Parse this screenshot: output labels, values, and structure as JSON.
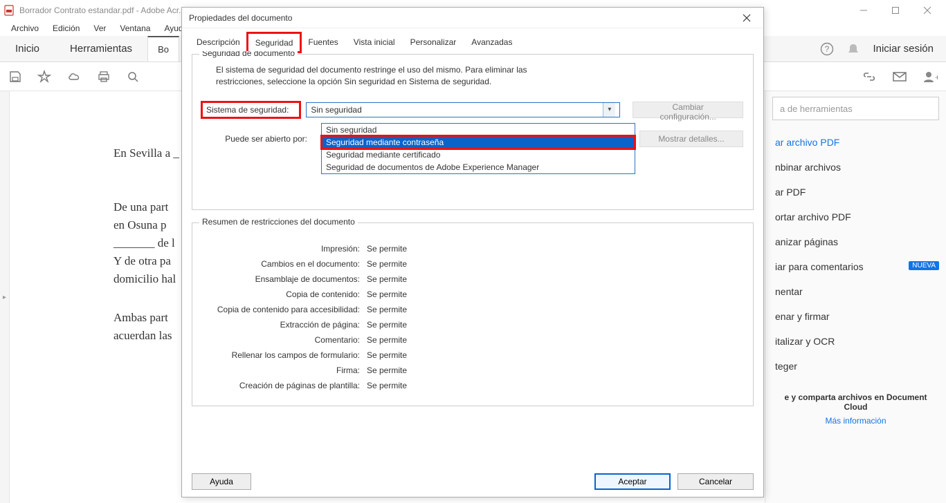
{
  "window": {
    "title": "Borrador Contrato estandar.pdf - Adobe Acr...",
    "controls": {
      "minimize": "min",
      "maximize": "max",
      "close": "close"
    }
  },
  "menubar": [
    "Archivo",
    "Edición",
    "Ver",
    "Ventana",
    "Ayuda"
  ],
  "tabbar": {
    "home": "Inicio",
    "tools": "Herramientas",
    "doctab": "Bo",
    "signin": "Iniciar sesión"
  },
  "rightpanel": {
    "search_placeholder": "a de herramientas",
    "items": [
      {
        "label": "ar archivo PDF",
        "blue": true
      },
      {
        "label": "nbinar archivos"
      },
      {
        "label": "ar PDF"
      },
      {
        "label": "ortar archivo PDF"
      },
      {
        "label": "anizar páginas"
      },
      {
        "label": "iar para comentarios",
        "badge": "NUEVA"
      },
      {
        "label": "nentar"
      },
      {
        "label": "enar y firmar"
      },
      {
        "label": "italizar y OCR"
      },
      {
        "label": "teger"
      }
    ],
    "promo_title": "e y comparta archivos en Document Cloud",
    "promo_link": "Más información"
  },
  "document": {
    "line1": "En Sevilla a _",
    "p1a": "  De una part",
    "p1b": "en  Osuna  p",
    "p1c": "_______ de l",
    "p1d": "  Y de otra pa",
    "p1e": "domicilio hal",
    "p2a": "  Ambas part",
    "p2b": "acuerdan las"
  },
  "dialog": {
    "title": "Propiedades del documento",
    "tabs": [
      "Descripción",
      "Seguridad",
      "Fuentes",
      "Vista inicial",
      "Personalizar",
      "Avanzadas"
    ],
    "active_tab": 1,
    "sec_legend": "Seguridad de documento",
    "intro": "El sistema de seguridad del documento restringe el uso del mismo. Para eliminar las restricciones, seleccione la opción Sin seguridad en Sistema de seguridad.",
    "label_system": "Sistema de seguridad:",
    "select_value": "Sin seguridad",
    "options": [
      "Sin seguridad",
      "Seguridad mediante contraseña",
      "Seguridad mediante certificado",
      "Seguridad de documentos de Adobe Experience Manager"
    ],
    "selected_option_index": 1,
    "btn_change": "Cambiar configuración...",
    "label_openby": "Puede ser abierto por:",
    "btn_details": "Mostrar detalles...",
    "restr_legend": "Resumen de restricciones del documento",
    "restrictions": [
      {
        "k": "Impresión:",
        "v": "Se permite"
      },
      {
        "k": "Cambios en el documento:",
        "v": "Se permite"
      },
      {
        "k": "Ensamblaje de documentos:",
        "v": "Se permite"
      },
      {
        "k": "Copia de contenido:",
        "v": "Se permite"
      },
      {
        "k": "Copia de contenido para accesibilidad:",
        "v": "Se permite"
      },
      {
        "k": "Extracción de página:",
        "v": "Se permite"
      },
      {
        "k": "Comentario:",
        "v": "Se permite"
      },
      {
        "k": "Rellenar los campos de formulario:",
        "v": "Se permite"
      },
      {
        "k": "Firma:",
        "v": "Se permite"
      },
      {
        "k": "Creación de páginas de plantilla:",
        "v": "Se permite"
      }
    ],
    "btn_help": "Ayuda",
    "btn_ok": "Aceptar",
    "btn_cancel": "Cancelar"
  }
}
